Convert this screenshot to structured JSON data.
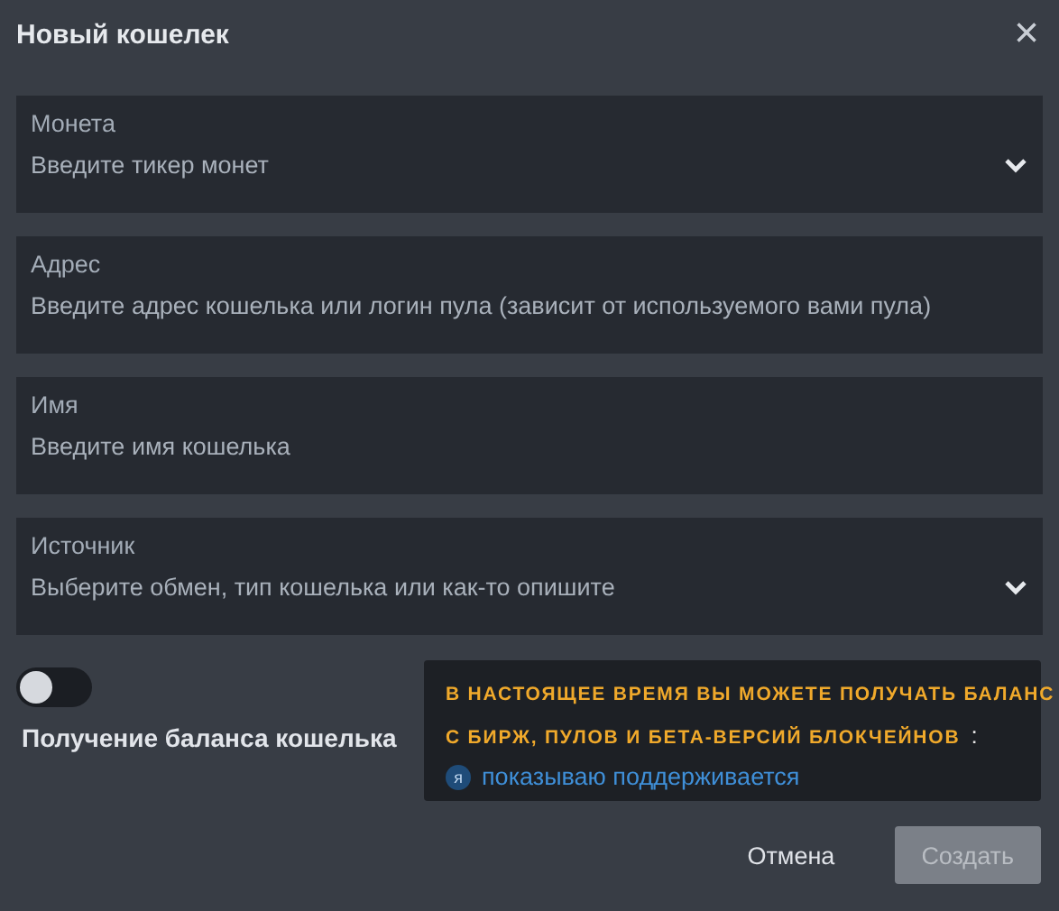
{
  "dialog": {
    "title": "Новый кошелек",
    "close": "×"
  },
  "fields": [
    {
      "kind": "select",
      "label": "Монета",
      "placeholder": "Введите тикер монет"
    },
    {
      "kind": "text",
      "label": "Адрес",
      "placeholder": "Введите адрес кошелька или логин пула (зависит от используемого вами пула)"
    },
    {
      "kind": "text",
      "label": "Имя",
      "placeholder": "Введите имя кошелька"
    },
    {
      "kind": "select",
      "label": "Источник",
      "placeholder": "Выберите обмен, тип кошелька или как-то опишите"
    }
  ],
  "balance_toggle": {
    "label": "Получение баланса кошелька",
    "on": false
  },
  "tooltip": {
    "line_1": "В НАСТОЯЩЕЕ ВРЕМЯ ВЫ МОЖЕТЕ ПОЛУЧАТЬ БАЛАНС",
    "line_2": "С БИРЖ, ПУЛОВ И БЕТА-ВЕРСИЙ БЛОКЧЕЙНОВ",
    "colon": ":",
    "badge": "я",
    "link": "показываю поддерживается"
  },
  "buttons": [
    {
      "kind": "plain",
      "label": "Отмена"
    },
    {
      "kind": "primary",
      "label": "Создать",
      "disabled": true
    }
  ]
}
